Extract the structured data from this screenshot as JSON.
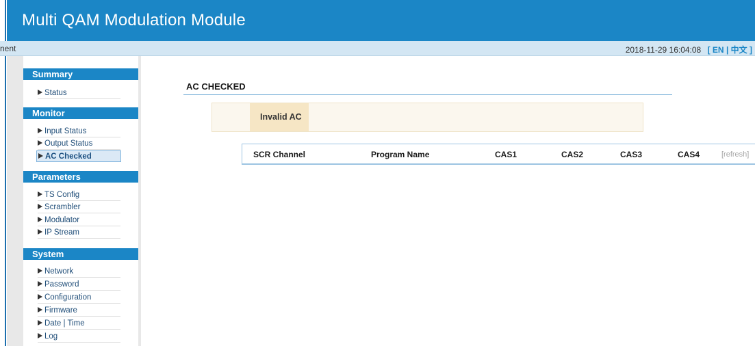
{
  "header": {
    "title": "Multi QAM Modulation Module"
  },
  "subbar": {
    "crumb": "nent",
    "datetime": "2018-11-29 16:04:08",
    "lang_open": "[",
    "lang_en": "EN",
    "lang_sep": "|",
    "lang_zh": "中文",
    "lang_close": "]"
  },
  "sidebar": {
    "summary": {
      "label": "Summary",
      "items": [
        "Status"
      ]
    },
    "monitor": {
      "label": "Monitor",
      "items": [
        "Input Status",
        "Output Status",
        "AC Checked"
      ],
      "active": "AC Checked"
    },
    "parameters": {
      "label": "Parameters",
      "items": [
        "TS Config",
        "Scrambler",
        "Modulator",
        "IP Stream"
      ]
    },
    "system": {
      "label": "System",
      "items": [
        "Network",
        "Password",
        "Configuration",
        "Firmware",
        "Date | Time",
        "Log"
      ]
    }
  },
  "main": {
    "page_title": "AC CHECKED",
    "ac_status": "Invalid AC",
    "table": {
      "headers": [
        "SCR Channel",
        "Program Name",
        "CAS1",
        "CAS2",
        "CAS3",
        "CAS4"
      ],
      "refresh": "[refresh]"
    }
  },
  "colors": {
    "header_bg": "#1b86c6",
    "subbar_bg": "#d3e6f3",
    "ac_badge_bg": "#f6e6c5"
  }
}
